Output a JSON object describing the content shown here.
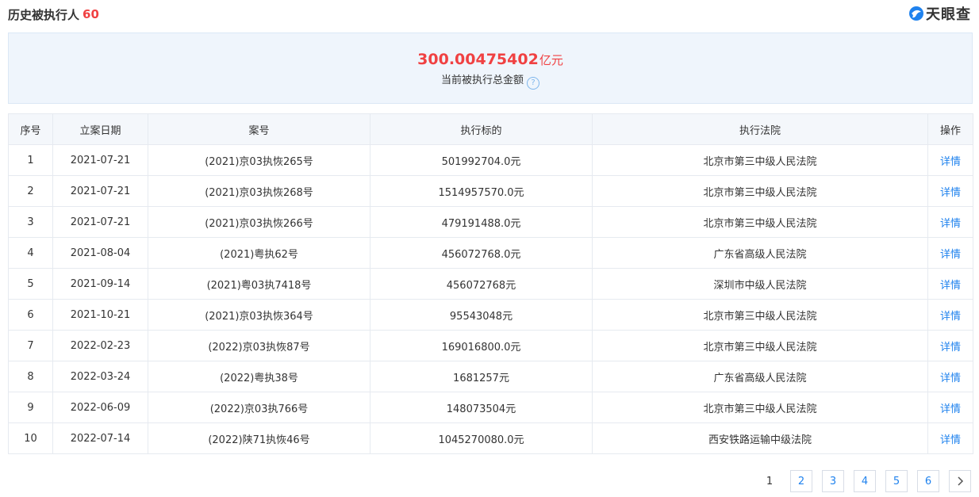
{
  "header": {
    "title": "历史被执行人",
    "count": "60",
    "brand": "天眼查"
  },
  "summary": {
    "amount": "300.00475402",
    "unit": "亿元",
    "label": "当前被执行总金额",
    "help_icon": "question-circle-icon"
  },
  "table": {
    "columns": [
      "序号",
      "立案日期",
      "案号",
      "执行标的",
      "执行法院",
      "操作"
    ],
    "rows": [
      {
        "no": "1",
        "date": "2021-07-21",
        "case": "(2021)京03执恢265号",
        "amount": "501992704.0元",
        "court": "北京市第三中级人民法院",
        "action": "详情"
      },
      {
        "no": "2",
        "date": "2021-07-21",
        "case": "(2021)京03执恢268号",
        "amount": "1514957570.0元",
        "court": "北京市第三中级人民法院",
        "action": "详情"
      },
      {
        "no": "3",
        "date": "2021-07-21",
        "case": "(2021)京03执恢266号",
        "amount": "479191488.0元",
        "court": "北京市第三中级人民法院",
        "action": "详情"
      },
      {
        "no": "4",
        "date": "2021-08-04",
        "case": "(2021)粤执62号",
        "amount": "456072768.0元",
        "court": "广东省高级人民法院",
        "action": "详情"
      },
      {
        "no": "5",
        "date": "2021-09-14",
        "case": "(2021)粤03执7418号",
        "amount": "456072768元",
        "court": "深圳市中级人民法院",
        "action": "详情"
      },
      {
        "no": "6",
        "date": "2021-10-21",
        "case": "(2021)京03执恢364号",
        "amount": "95543048元",
        "court": "北京市第三中级人民法院",
        "action": "详情"
      },
      {
        "no": "7",
        "date": "2022-02-23",
        "case": "(2022)京03执恢87号",
        "amount": "169016800.0元",
        "court": "北京市第三中级人民法院",
        "action": "详情"
      },
      {
        "no": "8",
        "date": "2022-03-24",
        "case": "(2022)粤执38号",
        "amount": "1681257元",
        "court": "广东省高级人民法院",
        "action": "详情"
      },
      {
        "no": "9",
        "date": "2022-06-09",
        "case": "(2022)京03执766号",
        "amount": "148073504元",
        "court": "北京市第三中级人民法院",
        "action": "详情"
      },
      {
        "no": "10",
        "date": "2022-07-14",
        "case": "(2022)陕71执恢46号",
        "amount": "1045270080.0元",
        "court": "西安铁路运输中级法院",
        "action": "详情"
      }
    ]
  },
  "pagination": {
    "pages": [
      "1",
      "2",
      "3",
      "4",
      "5",
      "6"
    ],
    "current": "1",
    "next_icon": "chevron-right-icon"
  },
  "colors": {
    "accent_red": "#f04142",
    "link_blue": "#1f82ee",
    "summary_bg": "#eff5fc",
    "header_bg": "#f4f7fb"
  }
}
